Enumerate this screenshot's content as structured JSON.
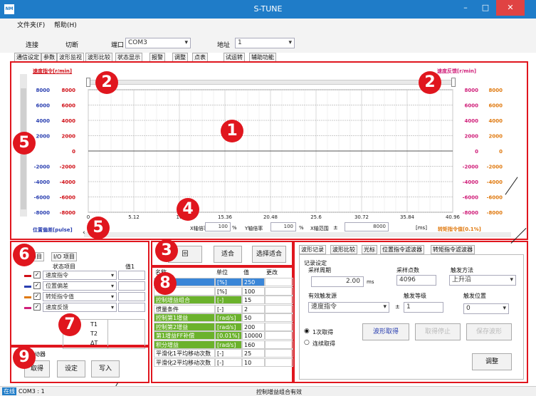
{
  "title": "S-TUNE",
  "title_logo": "NM",
  "menu": [
    "文件夹(F)",
    "帮助(H)"
  ],
  "toolbar": {
    "connect": "连接",
    "disconnect": "切断",
    "port_label": "端口",
    "port_value": "COM3",
    "addr_label": "地址",
    "addr_value": "1"
  },
  "tabs": [
    "通信设定",
    "参数",
    "波形监视",
    "波形比较",
    "状态显示",
    "报警",
    "调整",
    "点表",
    "试运转",
    "辅助功能"
  ],
  "chart": {
    "left_title": "速度指令[r/min]",
    "right_title": "速度反馈[r/min]",
    "yticks": [
      "8000",
      "6000",
      "4000",
      "2000",
      "0",
      "-2000",
      "-4000",
      "-6000",
      "-8000"
    ],
    "yticks_left_visible": [
      "8000",
      "6000",
      "4000",
      "2000",
      "",
      "-2000",
      "-4000",
      "-6000",
      "-8000"
    ],
    "xticks": [
      "0",
      "5.12",
      "10",
      "15.36",
      "20.48",
      "25.6",
      "30.72",
      "35.84",
      "40.96"
    ],
    "xmult_label": "X轴倍率",
    "xmult": "100",
    "ymult_label": "Y轴倍率",
    "ymult": "100",
    "pct": "%",
    "xrange_label": "X轴范围",
    "pm": "±",
    "xrange": "8000",
    "unit_ms": "[ms]",
    "bottom_left": "位置偏差[pulse]",
    "bottom_right": "转矩指令值[0.1%]"
  },
  "chart_data": {
    "type": "line",
    "x": [
      "0",
      "5.12",
      "10",
      "15.36",
      "20.48",
      "25.6",
      "30.72",
      "35.84",
      "40.96"
    ],
    "ylim": [
      -8000,
      8000
    ],
    "grid": true,
    "series": []
  },
  "badges": [
    "1",
    "2",
    "2",
    "3",
    "4",
    "5",
    "5",
    "6",
    "7",
    "8",
    "9"
  ],
  "status_panel": {
    "tab1": "项目",
    "tab2": "I/O 项目",
    "col1": "状态项目",
    "col2": "值1",
    "items": [
      {
        "label": "速度指令",
        "color": "#d01018"
      },
      {
        "label": "位置偏差",
        "color": "#2a3fb0"
      },
      {
        "label": "转矩指令值",
        "color": "#e07a10"
      },
      {
        "label": "速度反馈",
        "color": "#d0207a"
      }
    ],
    "t1": "T1",
    "t2": "T2",
    "dt": "ΔT"
  },
  "drive": {
    "group": "驱动器",
    "read": "取得",
    "set": "设定",
    "write": "写入"
  },
  "mid_buttons": {
    "b1": "回",
    "b2": "适合",
    "b3": "选择适合"
  },
  "param_table": {
    "headers": [
      "名称",
      "单位",
      "值",
      "更改"
    ],
    "rows": [
      {
        "name": "",
        "unit": "[%]",
        "value": "250",
        "style": "sel"
      },
      {
        "name": "",
        "unit": "[%]",
        "value": "100",
        "style": ""
      },
      {
        "name": "控制增益组合",
        "unit": "[-]",
        "value": "15",
        "style": "grn"
      },
      {
        "name": "惯量条件",
        "unit": "[-]",
        "value": "2",
        "style": ""
      },
      {
        "name": "控制第1增益",
        "unit": "[rad/s]",
        "value": "50",
        "style": "grn"
      },
      {
        "name": "控制第2增益",
        "unit": "[rad/s]",
        "value": "200",
        "style": "grn"
      },
      {
        "name": "第1增益FF补偿",
        "unit": "[0.01%]",
        "value": "10000",
        "style": "grn"
      },
      {
        "name": "积分增益",
        "unit": "[rad/s]",
        "value": "160",
        "style": "grn"
      },
      {
        "name": "平滑化1平均移动次数",
        "unit": "[-]",
        "value": "25",
        "style": ""
      },
      {
        "name": "平滑化2平均移动次数",
        "unit": "[-]",
        "value": "10",
        "style": ""
      }
    ]
  },
  "record": {
    "tabs": [
      "波形记录",
      "波形比较",
      "光标",
      "位置指令滤波器",
      "转矩指令滤波器"
    ],
    "group": "记录设定",
    "period_label": "采样周期",
    "period": "2.00",
    "ms": "ms",
    "points_label": "采样点数",
    "points": "4096",
    "trig_label": "触发方法",
    "trig": "上升沿",
    "src_label": "有效触发源",
    "src": "速度指令",
    "level_label": "触发等级",
    "pm": "±",
    "level": "1",
    "pos_label": "触发位置",
    "pos": "0",
    "once": "1次取得",
    "cont": "连续取得",
    "get_btn": "波形取得",
    "stop_btn": "取得停止",
    "save_btn": "保存波形",
    "adjust_btn": "调整"
  },
  "status_bar": {
    "online": "在线",
    "port": "COM3 : 1",
    "message": "控制增益组合有效"
  }
}
